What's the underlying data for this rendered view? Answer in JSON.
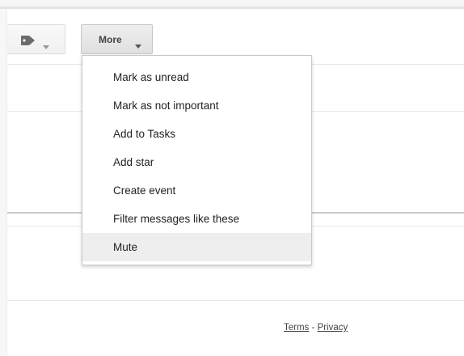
{
  "toolbar": {
    "labels_icon": "tag-icon",
    "labels_caret_icon": "chevron-down-icon",
    "more_label": "More",
    "more_caret_icon": "chevron-down-icon"
  },
  "menu": {
    "items": [
      {
        "label": "Mark as unread"
      },
      {
        "label": "Mark as not important"
      },
      {
        "label": "Add to Tasks"
      },
      {
        "label": "Add star"
      },
      {
        "label": "Create event"
      },
      {
        "label": "Filter messages like these"
      },
      {
        "label": "Mute",
        "highlighted": true
      }
    ]
  },
  "footer": {
    "terms": "Terms",
    "separator": " - ",
    "privacy": "Privacy"
  },
  "colors": {
    "menu_highlight": "#eeeeee",
    "more_button_bg": "#e6e6e6",
    "text": "#222222"
  }
}
